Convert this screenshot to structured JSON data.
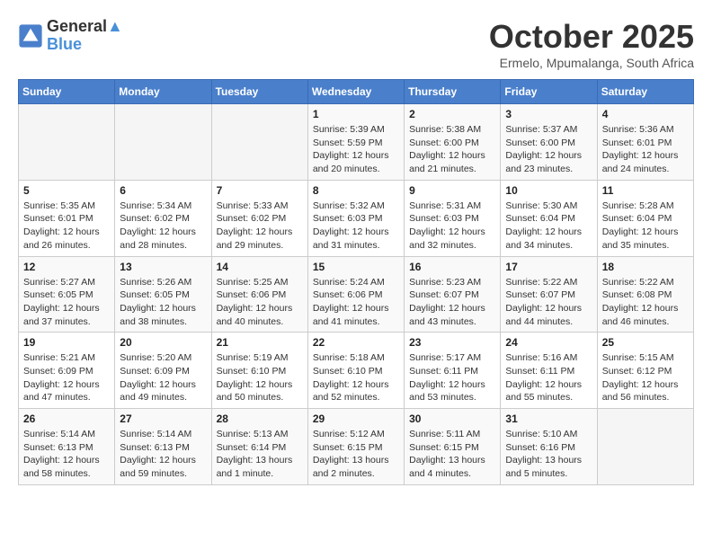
{
  "header": {
    "logo_line1": "General",
    "logo_line2": "Blue",
    "month": "October 2025",
    "location": "Ermelo, Mpumalanga, South Africa"
  },
  "days_of_week": [
    "Sunday",
    "Monday",
    "Tuesday",
    "Wednesday",
    "Thursday",
    "Friday",
    "Saturday"
  ],
  "weeks": [
    [
      {
        "day": "",
        "info": ""
      },
      {
        "day": "",
        "info": ""
      },
      {
        "day": "",
        "info": ""
      },
      {
        "day": "1",
        "info": "Sunrise: 5:39 AM\nSunset: 5:59 PM\nDaylight: 12 hours and 20 minutes."
      },
      {
        "day": "2",
        "info": "Sunrise: 5:38 AM\nSunset: 6:00 PM\nDaylight: 12 hours and 21 minutes."
      },
      {
        "day": "3",
        "info": "Sunrise: 5:37 AM\nSunset: 6:00 PM\nDaylight: 12 hours and 23 minutes."
      },
      {
        "day": "4",
        "info": "Sunrise: 5:36 AM\nSunset: 6:01 PM\nDaylight: 12 hours and 24 minutes."
      }
    ],
    [
      {
        "day": "5",
        "info": "Sunrise: 5:35 AM\nSunset: 6:01 PM\nDaylight: 12 hours and 26 minutes."
      },
      {
        "day": "6",
        "info": "Sunrise: 5:34 AM\nSunset: 6:02 PM\nDaylight: 12 hours and 28 minutes."
      },
      {
        "day": "7",
        "info": "Sunrise: 5:33 AM\nSunset: 6:02 PM\nDaylight: 12 hours and 29 minutes."
      },
      {
        "day": "8",
        "info": "Sunrise: 5:32 AM\nSunset: 6:03 PM\nDaylight: 12 hours and 31 minutes."
      },
      {
        "day": "9",
        "info": "Sunrise: 5:31 AM\nSunset: 6:03 PM\nDaylight: 12 hours and 32 minutes."
      },
      {
        "day": "10",
        "info": "Sunrise: 5:30 AM\nSunset: 6:04 PM\nDaylight: 12 hours and 34 minutes."
      },
      {
        "day": "11",
        "info": "Sunrise: 5:28 AM\nSunset: 6:04 PM\nDaylight: 12 hours and 35 minutes."
      }
    ],
    [
      {
        "day": "12",
        "info": "Sunrise: 5:27 AM\nSunset: 6:05 PM\nDaylight: 12 hours and 37 minutes."
      },
      {
        "day": "13",
        "info": "Sunrise: 5:26 AM\nSunset: 6:05 PM\nDaylight: 12 hours and 38 minutes."
      },
      {
        "day": "14",
        "info": "Sunrise: 5:25 AM\nSunset: 6:06 PM\nDaylight: 12 hours and 40 minutes."
      },
      {
        "day": "15",
        "info": "Sunrise: 5:24 AM\nSunset: 6:06 PM\nDaylight: 12 hours and 41 minutes."
      },
      {
        "day": "16",
        "info": "Sunrise: 5:23 AM\nSunset: 6:07 PM\nDaylight: 12 hours and 43 minutes."
      },
      {
        "day": "17",
        "info": "Sunrise: 5:22 AM\nSunset: 6:07 PM\nDaylight: 12 hours and 44 minutes."
      },
      {
        "day": "18",
        "info": "Sunrise: 5:22 AM\nSunset: 6:08 PM\nDaylight: 12 hours and 46 minutes."
      }
    ],
    [
      {
        "day": "19",
        "info": "Sunrise: 5:21 AM\nSunset: 6:09 PM\nDaylight: 12 hours and 47 minutes."
      },
      {
        "day": "20",
        "info": "Sunrise: 5:20 AM\nSunset: 6:09 PM\nDaylight: 12 hours and 49 minutes."
      },
      {
        "day": "21",
        "info": "Sunrise: 5:19 AM\nSunset: 6:10 PM\nDaylight: 12 hours and 50 minutes."
      },
      {
        "day": "22",
        "info": "Sunrise: 5:18 AM\nSunset: 6:10 PM\nDaylight: 12 hours and 52 minutes."
      },
      {
        "day": "23",
        "info": "Sunrise: 5:17 AM\nSunset: 6:11 PM\nDaylight: 12 hours and 53 minutes."
      },
      {
        "day": "24",
        "info": "Sunrise: 5:16 AM\nSunset: 6:11 PM\nDaylight: 12 hours and 55 minutes."
      },
      {
        "day": "25",
        "info": "Sunrise: 5:15 AM\nSunset: 6:12 PM\nDaylight: 12 hours and 56 minutes."
      }
    ],
    [
      {
        "day": "26",
        "info": "Sunrise: 5:14 AM\nSunset: 6:13 PM\nDaylight: 12 hours and 58 minutes."
      },
      {
        "day": "27",
        "info": "Sunrise: 5:14 AM\nSunset: 6:13 PM\nDaylight: 12 hours and 59 minutes."
      },
      {
        "day": "28",
        "info": "Sunrise: 5:13 AM\nSunset: 6:14 PM\nDaylight: 13 hours and 1 minute."
      },
      {
        "day": "29",
        "info": "Sunrise: 5:12 AM\nSunset: 6:15 PM\nDaylight: 13 hours and 2 minutes."
      },
      {
        "day": "30",
        "info": "Sunrise: 5:11 AM\nSunset: 6:15 PM\nDaylight: 13 hours and 4 minutes."
      },
      {
        "day": "31",
        "info": "Sunrise: 5:10 AM\nSunset: 6:16 PM\nDaylight: 13 hours and 5 minutes."
      },
      {
        "day": "",
        "info": ""
      }
    ]
  ]
}
